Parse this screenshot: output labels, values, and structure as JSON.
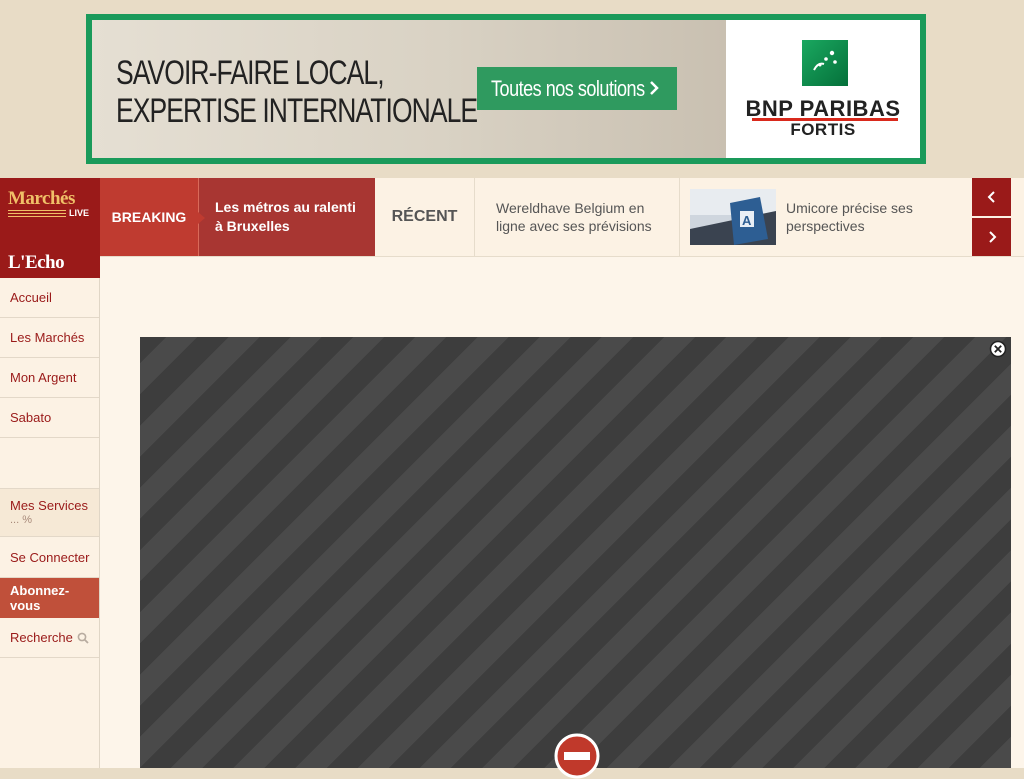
{
  "ad": {
    "headline_line1": "SAVOIR-FAIRE LOCAL,",
    "headline_line2": "EXPERTISE INTERNATIONALE",
    "cta_label": "Toutes nos solutions",
    "brand_name": "BNP PARIBAS",
    "brand_sub": "FORTIS",
    "accent_color": "#1a9a5a"
  },
  "brand": {
    "marches": "Marchés",
    "live": "LIVE",
    "echo": "L'Echo",
    "color": "#9a1a19"
  },
  "sidebar": {
    "items": [
      {
        "label": "Accueil"
      },
      {
        "label": "Les Marchés"
      },
      {
        "label": "Mon Argent"
      },
      {
        "label": "Sabato"
      }
    ],
    "services_label": "Mes Services",
    "services_sub": "... %",
    "login_label": "Se Connecter",
    "subscribe_label": "Abonnez-vous",
    "search_label": "Recherche"
  },
  "ticker": {
    "breaking_label": "BREAKING",
    "breaking_text": "Les métros au ralenti à Bruxelles",
    "recent_label": "RÉCENT",
    "recent_items": [
      {
        "text": "Wereldhave Belgium en ligne avec ses prévisions"
      },
      {
        "text": "Umicore précise ses perspectives"
      }
    ]
  },
  "icons": {
    "prev": "chevron-left-icon",
    "next": "chevron-right-icon",
    "close": "close-circle-icon",
    "blocked": "no-entry-icon",
    "search": "search-icon"
  }
}
